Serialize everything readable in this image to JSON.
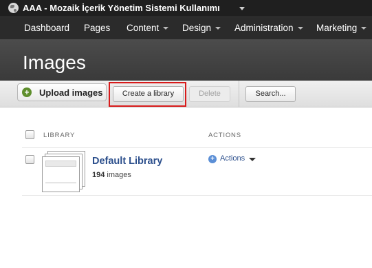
{
  "site": {
    "title": "AAA - Mozaik İçerik Yönetim Sistemi Kullanımı"
  },
  "nav": {
    "items": [
      {
        "label": "Dashboard",
        "dropdown": false
      },
      {
        "label": "Pages",
        "dropdown": false
      },
      {
        "label": "Content",
        "dropdown": true
      },
      {
        "label": "Design",
        "dropdown": true
      },
      {
        "label": "Administration",
        "dropdown": true
      },
      {
        "label": "Marketing",
        "dropdown": true
      }
    ]
  },
  "page": {
    "title": "Images"
  },
  "toolbar": {
    "upload_label": "Upload images",
    "create_label": "Create a library",
    "delete_label": "Delete",
    "search_label": "Search..."
  },
  "table": {
    "columns": {
      "library": "LIBRARY",
      "actions": "ACTIONS"
    },
    "rows": [
      {
        "name": "Default Library",
        "count": "194",
        "count_suffix": "images",
        "actions_label": "Actions"
      }
    ]
  },
  "colors": {
    "highlight": "#d81b1b",
    "link": "#2c4f8c",
    "upload_icon": "#5e8e2c"
  }
}
